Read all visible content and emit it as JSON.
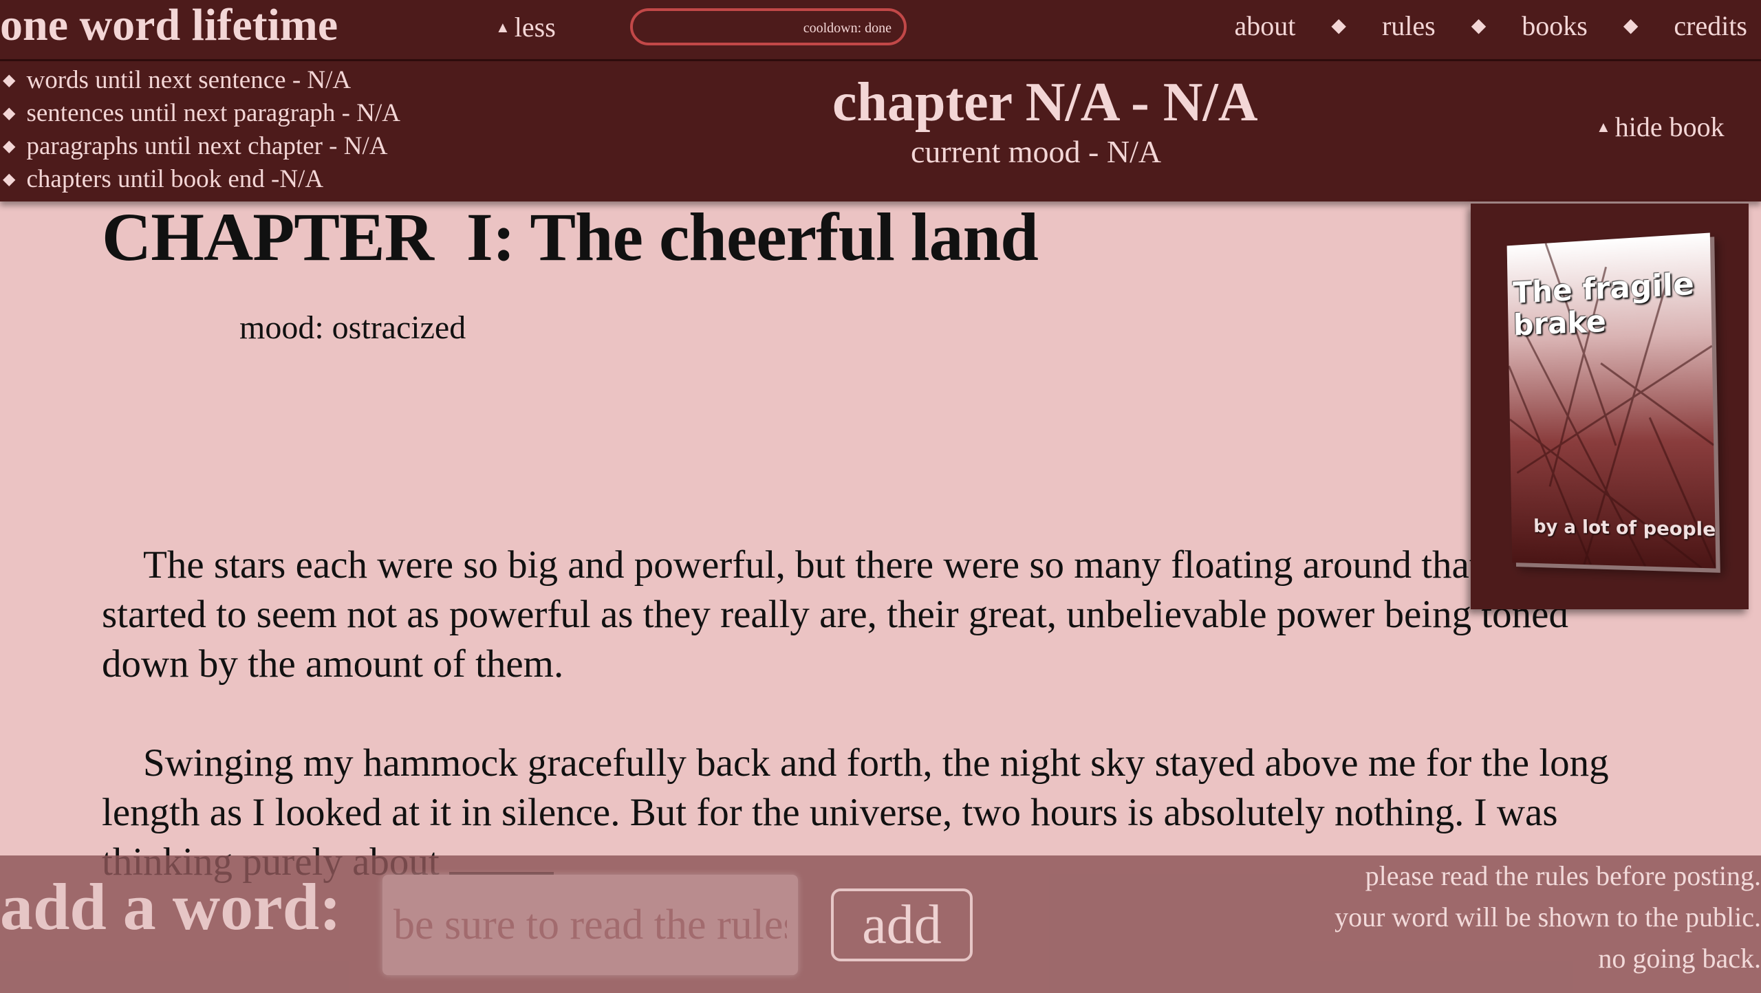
{
  "header": {
    "site_title": "one word lifetime",
    "less_label": "less",
    "cooldown_label": "cooldown: done",
    "nav": {
      "about": "about",
      "rules": "rules",
      "books": "books",
      "credits": "credits"
    }
  },
  "info": {
    "stats": [
      "words until next sentence - N/A",
      "sentences until next paragraph - N/A",
      "paragraphs until next chapter - N/A",
      "chapters until book end -N/A"
    ],
    "chapter_heading": "chapter N/A - N/A",
    "current_mood": "current mood - N/A",
    "hide_book_label": "hide book"
  },
  "book": {
    "chapter_title": "CHAPTER  I: The cheerful land",
    "mood": "mood: ostracized",
    "paragraphs": [
      "The stars each were so big and powerful, but there were so many floating around that they started to seem not as powerful as they really are, their great, unbelievable power being toned down by the amount of them.",
      "Swinging my hammock gracefully back and forth, the night sky stayed above me for the long length as I looked at it in silence. But for the universe, two hours is absolutely nothing. I was thinking purely about"
    ],
    "cover": {
      "title": "The fragile brake",
      "author": "by a lot of people"
    }
  },
  "footer": {
    "add_label": "add a word:",
    "input_placeholder": "be sure to read the rules",
    "add_button": "add",
    "notice": [
      "please read the rules before posting.",
      "your word will be shown to the public.",
      "no going back."
    ]
  },
  "colors": {
    "page_bg": "#ebc3c3",
    "bar_bg": "#4d1b1b",
    "bar_text": "#f3d6d6",
    "cooldown_border": "#c24848",
    "footer_bg": "#8c5558"
  }
}
